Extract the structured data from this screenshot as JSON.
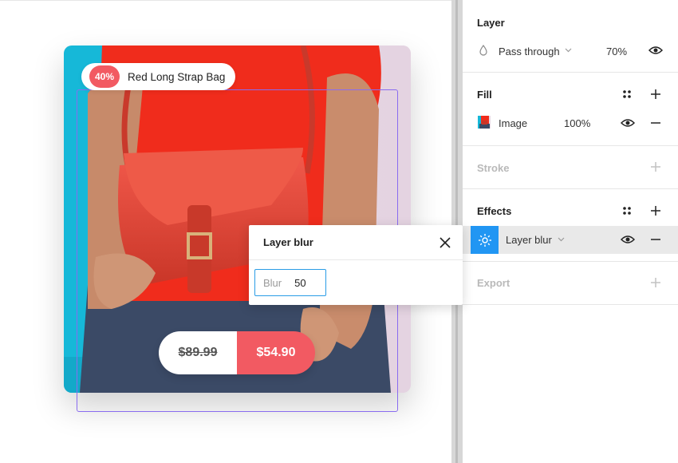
{
  "product_card": {
    "discount": "40%",
    "title": "Red Long Strap Bag",
    "old_price": "$89.99",
    "new_price": "$54.90"
  },
  "blur_popup": {
    "title": "Layer blur",
    "field_label": "Blur",
    "field_value": "50"
  },
  "panel": {
    "layer": {
      "title": "Layer",
      "blend_mode": "Pass through",
      "opacity": "70%"
    },
    "fill": {
      "title": "Fill",
      "type": "Image",
      "opacity": "100%"
    },
    "stroke": {
      "title": "Stroke"
    },
    "effects": {
      "title": "Effects",
      "effect_name": "Layer blur"
    },
    "export": {
      "title": "Export"
    }
  },
  "colors": {
    "accent_red": "#f25a62",
    "selection": "#8a6cf0",
    "focus_blue": "#2a9ce6",
    "effect_icon_bg": "#2196f3"
  }
}
